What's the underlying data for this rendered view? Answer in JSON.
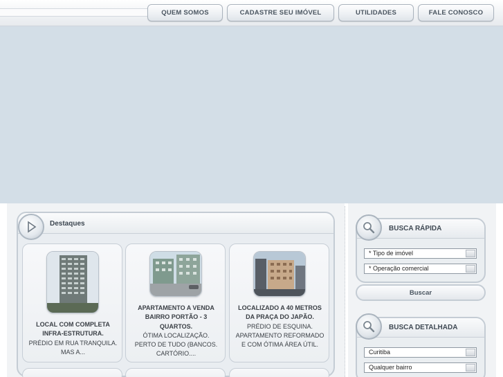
{
  "nav": {
    "items": [
      {
        "label": "QUEM SOMOS"
      },
      {
        "label": "CADASTRE SEU IMÓVEL"
      },
      {
        "label": "UTILIDADES"
      },
      {
        "label": "FALE CONOSCO"
      }
    ]
  },
  "destaques": {
    "title": "Destaques",
    "cards": [
      {
        "headline": "LOCAL COM COMPLETA INFRA-ESTRUTURA.",
        "text": "PRÉDIO EM RUA TRANQUILA. MAS A..."
      },
      {
        "headline": "APARTAMENTO A VENDA BAIRRO PORTÃO - 3 QUARTOS.",
        "text": "ÓTIMA LOCALIZAÇÃO. PERTO DE TUDO (BANCOS. CARTÓRIO...."
      },
      {
        "headline": "LOCALIZADO A 40 METROS DA PRAÇA DO JAPÃO.",
        "text": "PRÉDIO DE ESQUINA. APARTAMENTO REFORMADO E COM ÓTIMA ÁREA ÚTIL."
      }
    ]
  },
  "busca_rapida": {
    "title": "BUSCA RÁPIDA",
    "tipo_imovel": "* Tipo de imóvel",
    "operacao": "* Operação comercial",
    "button": "Buscar"
  },
  "busca_detalhada": {
    "title": "BUSCA DETALHADA",
    "cidade": "Curitiba",
    "bairro": "Qualquer bairro"
  },
  "colors": {
    "banner": "#d3dee7",
    "panel": "#e9edf1",
    "border": "#c4ccd4"
  },
  "icons": {
    "destaques": "play-icon",
    "busca": "magnifier-icon"
  }
}
